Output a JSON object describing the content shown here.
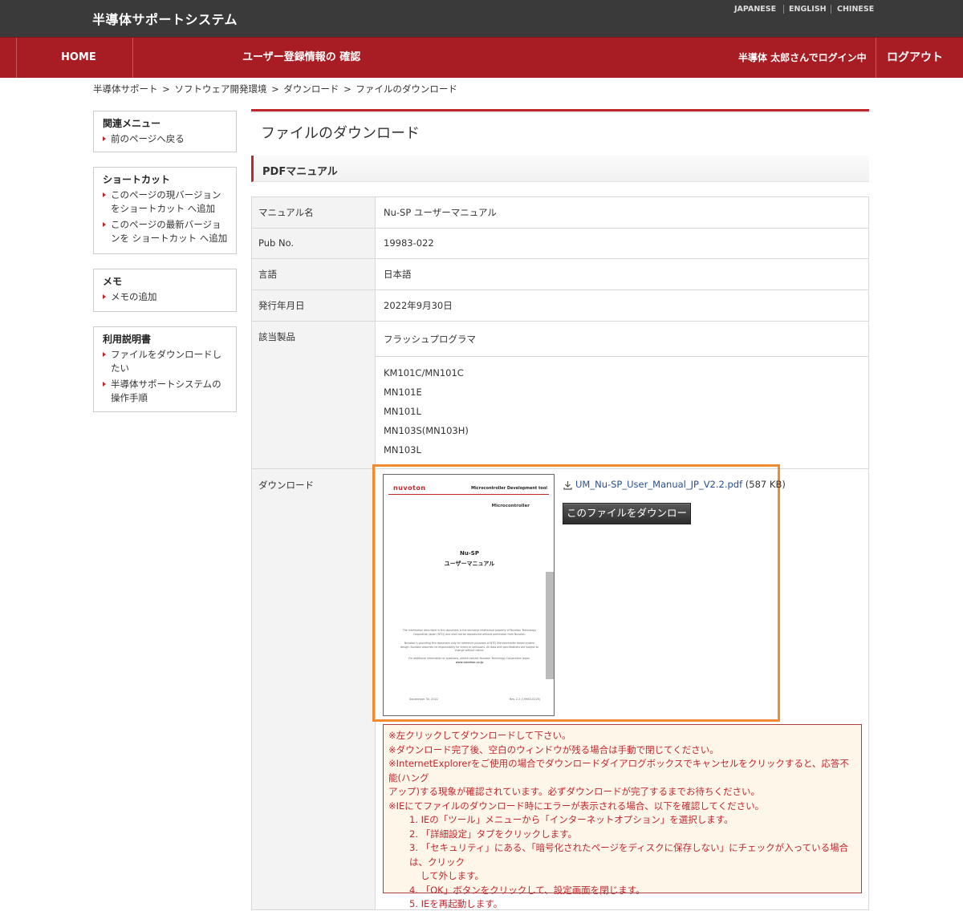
{
  "header": {
    "site_title": "半導体サポートシステム",
    "languages": [
      "JAPANESE",
      "ENGLISH",
      "CHINESE"
    ]
  },
  "nav": {
    "home": "HOME",
    "user_info": "ユーザー登録情報の 確認",
    "login_status": "半導体 太郎さんでログイン中",
    "logout": "ログアウト"
  },
  "breadcrumb": [
    "半導体サポート",
    "ソフトウェア開発環境",
    "ダウンロード",
    "ファイルのダウンロード"
  ],
  "breadcrumb_sep": ">",
  "sidebar": {
    "related": {
      "title": "関連メニュー",
      "links": [
        "前のページへ戻る"
      ]
    },
    "shortcut": {
      "title": "ショートカット",
      "links": [
        "このページの現バージョンをショートカット へ追加",
        "このページの最新バージョンを ショートカット へ追加"
      ]
    },
    "memo": {
      "title": "メモ",
      "links": [
        "メモの追加"
      ]
    },
    "help": {
      "title": "利用説明書",
      "links": [
        "ファイルをダウンロードしたい",
        "半導体サポートシステムの操作手順"
      ]
    }
  },
  "main": {
    "page_title": "ファイルのダウンロード",
    "section_title": "PDFマニュアル",
    "rows": {
      "manual_name": {
        "key": "マニュアル名",
        "value": "Nu-SP ユーザーマニュアル"
      },
      "pub_no": {
        "key": "Pub No.",
        "value": "19983-022"
      },
      "language": {
        "key": "言語",
        "value": "日本語"
      },
      "issue_date": {
        "key": "発行年月日",
        "value": "2022年9月30日"
      },
      "products": {
        "key": "該当製品",
        "category": "フラッシュプログラマ",
        "items": [
          "KM101C/MN101C",
          "MN101E",
          "MN101L",
          "MN103S(MN103H)",
          "MN103L"
        ]
      },
      "download": {
        "key": "ダウンロード"
      }
    },
    "download": {
      "filename": "UM_Nu-SP_User_Manual_JP_V2.2.pdf",
      "size": " (587 KB)",
      "button": "このファイルをダウンロード",
      "highlight_color": "#f28a30"
    },
    "thumbnail": {
      "logo": "nuvoton",
      "header": "Microcontroller Development tool",
      "sub": "Microcontroller",
      "title1": "Nu-SP",
      "title2": "ユーザーマニュアル",
      "small1": "The information described in this document is the exclusive intellectual property of Nuvoton Technology Corporation Japan (NTCJ) and shall not be reproduced without permission from Nuvoton.",
      "small2": "Nuvoton is providing this document only for reference purposes of NTCJ Microcontroller based system design. Nuvoton assumes no responsibility for errors or omissions. All data and specifications are subject to change without notice.",
      "small3": "For additional information or questions, please contact Nuvoton Technology Corporation Japan.",
      "small4": "www.nuvoton.co.jp",
      "foot_left": "September 30, 2022",
      "foot_right": "Rev 2.2 (19983-022E)"
    },
    "notice": [
      "※左クリックしてダウンロードして下さい。",
      "※ダウンロード完了後、空白のウィンドウが残る場合は手動で閉じてください。",
      "※InternetExplorerをご使用の場合でダウンロードダイアログボックスでキャンセルをクリックすると、応答不能(ハング",
      "アップ)する現象が確認されています。必ずダウンロードが完了するまでお待ちください。",
      "※IEにてファイルのダウンロード時にエラーが表示される場合、以下を確認してください。"
    ],
    "notice_steps": [
      "1. IEの「ツール」メニューから「インターネットオプション」を選択します。",
      "2. 「詳細設定」タブをクリックします。",
      "3. 「セキュリティ」にある、「暗号化されたページをディスクに保存しない」にチェックが入っている場合は、クリック",
      "して外します。",
      "4. 「OK」ボタンをクリックして、設定画面を閉じます。",
      "5. IEを再起動します。"
    ],
    "accent_color": "#c0272d"
  }
}
